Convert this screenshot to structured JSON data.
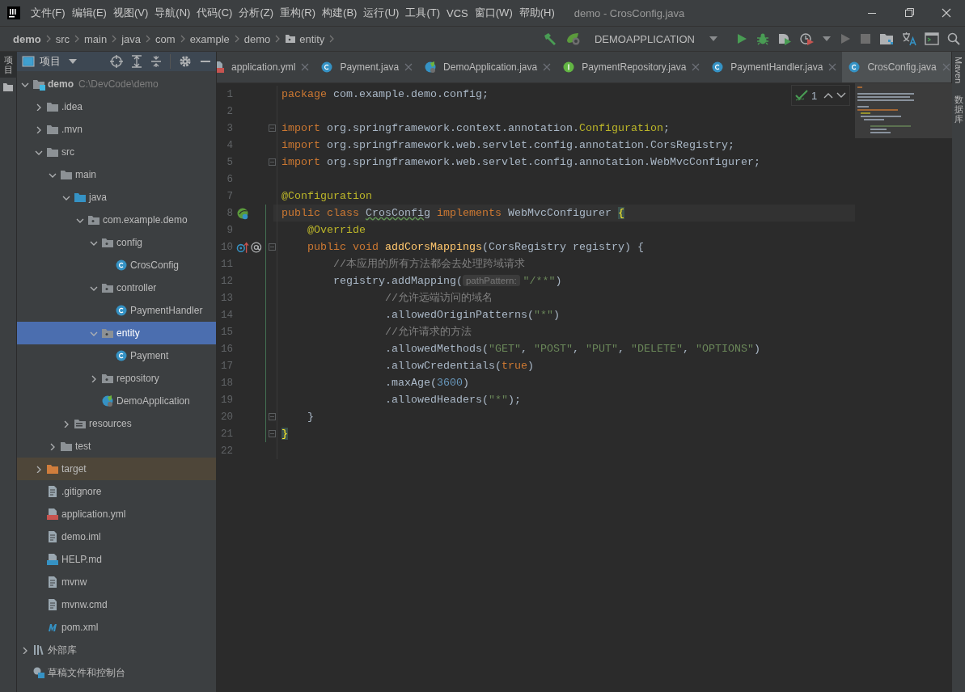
{
  "window": {
    "title": "demo - CrosConfig.java"
  },
  "menu": [
    "文件(F)",
    "编辑(E)",
    "视图(V)",
    "导航(N)",
    "代码(C)",
    "分析(Z)",
    "重构(R)",
    "构建(B)",
    "运行(U)",
    "工具(T)",
    "VCS",
    "窗口(W)",
    "帮助(H)"
  ],
  "breadcrumbs": [
    {
      "label": "demo",
      "kind": "root"
    },
    {
      "label": "src",
      "kind": "plain"
    },
    {
      "label": "main",
      "kind": "plain"
    },
    {
      "label": "java",
      "kind": "plain"
    },
    {
      "label": "com",
      "kind": "plain"
    },
    {
      "label": "example",
      "kind": "plain"
    },
    {
      "label": "demo",
      "kind": "plain"
    },
    {
      "label": "entity",
      "kind": "folder"
    }
  ],
  "run_config": {
    "label": "DEMOAPPLICATION"
  },
  "left_strip": {
    "label": "项目"
  },
  "project_panel": {
    "title": "项目"
  },
  "tree": [
    {
      "label": "demo",
      "path": "C:\\DevCode\\demo",
      "kind": "module",
      "selected": false,
      "expanded": true,
      "children": [
        {
          "label": ".idea",
          "kind": "folder",
          "selected": false,
          "expanded": false
        },
        {
          "label": ".mvn",
          "kind": "folder",
          "selected": false,
          "expanded": false
        },
        {
          "label": "src",
          "kind": "folder",
          "selected": false,
          "expanded": true,
          "children": [
            {
              "label": "main",
              "kind": "folder",
              "selected": false,
              "expanded": true,
              "children": [
                {
                  "label": "java",
                  "kind": "source",
                  "selected": false,
                  "expanded": true,
                  "children": [
                    {
                      "label": "com.example.demo",
                      "kind": "package",
                      "selected": false,
                      "expanded": true,
                      "children": [
                        {
                          "label": "config",
                          "kind": "package",
                          "selected": false,
                          "expanded": true,
                          "children": [
                            {
                              "label": "CrosConfig",
                              "kind": "class",
                              "selected": false
                            }
                          ]
                        },
                        {
                          "label": "controller",
                          "kind": "package",
                          "selected": false,
                          "expanded": true,
                          "children": [
                            {
                              "label": "PaymentHandler",
                              "kind": "class",
                              "selected": false
                            }
                          ]
                        },
                        {
                          "label": "entity",
                          "kind": "package",
                          "selected": true,
                          "expanded": true,
                          "children": [
                            {
                              "label": "Payment",
                              "kind": "class",
                              "selected": false
                            }
                          ]
                        },
                        {
                          "label": "repository",
                          "kind": "package",
                          "selected": false,
                          "expanded": false
                        },
                        {
                          "label": "DemoApplication",
                          "kind": "spring",
                          "selected": false
                        }
                      ]
                    }
                  ]
                },
                {
                  "label": "resources",
                  "kind": "resources",
                  "selected": false,
                  "expanded": false
                }
              ]
            },
            {
              "label": "test",
              "kind": "folder",
              "selected": false,
              "expanded": false
            }
          ]
        },
        {
          "label": "target",
          "kind": "excluded",
          "selected": false,
          "expanded": false
        },
        {
          "label": ".gitignore",
          "kind": "file",
          "selected": false
        },
        {
          "label": "application.yml",
          "kind": "yml",
          "selected": false
        },
        {
          "label": "demo.iml",
          "kind": "file",
          "selected": false
        },
        {
          "label": "HELP.md",
          "kind": "md",
          "selected": false
        },
        {
          "label": "mvnw",
          "kind": "file",
          "selected": false
        },
        {
          "label": "mvnw.cmd",
          "kind": "file",
          "selected": false
        },
        {
          "label": "pom.xml",
          "kind": "pom",
          "selected": false
        }
      ]
    },
    {
      "label": "外部库",
      "kind": "library",
      "selected": false,
      "expanded": false
    },
    {
      "label": "草稿文件和控制台",
      "kind": "scratch",
      "selected": false
    }
  ],
  "tabs": [
    {
      "label": "application.yml",
      "kind": "yml",
      "selected": false
    },
    {
      "label": "Payment.java",
      "kind": "class",
      "selected": false
    },
    {
      "label": "DemoApplication.java",
      "kind": "spring",
      "selected": false
    },
    {
      "label": "PaymentRepository.java",
      "kind": "interface",
      "selected": false
    },
    {
      "label": "PaymentHandler.java",
      "kind": "class",
      "selected": false
    },
    {
      "label": "CrosConfig.java",
      "kind": "class",
      "selected": true
    }
  ],
  "inspection": {
    "count": "1"
  },
  "right_strip": [
    {
      "label": "Maven",
      "kind": "latin"
    },
    {
      "label": "数据库",
      "kind": "cjk"
    }
  ],
  "code": [
    {
      "number": "1",
      "current": false,
      "changed": false,
      "fold": false,
      "tokens": [
        {
          "kind": "keyword",
          "text": "package"
        },
        {
          "kind": "plain",
          "text": " com.example.demo.config;"
        }
      ]
    },
    {
      "number": "2",
      "current": false,
      "changed": false,
      "fold": false
    },
    {
      "number": "3",
      "current": false,
      "changed": false,
      "fold": true,
      "tokens": [
        {
          "kind": "keyword",
          "text": "import"
        },
        {
          "kind": "plain",
          "text": " org.springframework.context.annotation."
        },
        {
          "kind": "annotation",
          "text": "Configuration"
        },
        {
          "kind": "plain",
          "text": ";"
        }
      ]
    },
    {
      "number": "4",
      "current": false,
      "changed": false,
      "fold": false,
      "tokens": [
        {
          "kind": "keyword",
          "text": "import"
        },
        {
          "kind": "plain",
          "text": " org.springframework.web.servlet.config.annotation.CorsRegistry;"
        }
      ]
    },
    {
      "number": "5",
      "current": false,
      "changed": false,
      "fold": true,
      "tokens": [
        {
          "kind": "keyword",
          "text": "import"
        },
        {
          "kind": "plain",
          "text": " org.springframework.web.servlet.config.annotation.WebMvcConfigurer;"
        }
      ]
    },
    {
      "number": "6",
      "current": false,
      "changed": false,
      "fold": false
    },
    {
      "number": "7",
      "current": false,
      "changed": false,
      "fold": false,
      "tokens": [
        {
          "kind": "annotation",
          "text": "@Configuration"
        }
      ]
    },
    {
      "number": "8",
      "current": true,
      "changed": true,
      "fold": false,
      "gutter": [
        {
          "kind": "bean"
        }
      ],
      "tokens": [
        {
          "kind": "keyword",
          "text": "public class "
        },
        {
          "kind": "typo",
          "text": "CrosConfig"
        },
        {
          "kind": "keyword",
          "text": " implements"
        },
        {
          "kind": "plain",
          "text": " WebMvcConfigurer "
        },
        {
          "kind": "brace",
          "text": "{"
        }
      ]
    },
    {
      "number": "9",
      "current": false,
      "changed": true,
      "fold": false,
      "tokens": [
        {
          "kind": "annotation",
          "text": "    @Override"
        }
      ]
    },
    {
      "number": "10",
      "current": false,
      "changed": true,
      "fold": true,
      "gutter": [
        {
          "kind": "override"
        },
        {
          "kind": "at"
        }
      ],
      "tokens": [
        {
          "kind": "keyword",
          "text": "    public void "
        },
        {
          "kind": "method",
          "text": "addCorsMappings"
        },
        {
          "kind": "plain",
          "text": "(CorsRegistry registry) {"
        }
      ]
    },
    {
      "number": "11",
      "current": false,
      "changed": true,
      "fold": false,
      "tokens": [
        {
          "kind": "comment",
          "text": "        //本应用的所有方法都会去处理跨域请求"
        }
      ]
    },
    {
      "number": "12",
      "current": false,
      "changed": true,
      "fold": false,
      "tokens": [
        {
          "kind": "plain",
          "text": "        registry.addMapping("
        },
        {
          "kind": "hint",
          "text": "pathPattern:"
        },
        {
          "kind": "string",
          "text": "\"/**\""
        },
        {
          "kind": "plain",
          "text": ")"
        }
      ]
    },
    {
      "number": "13",
      "current": false,
      "changed": true,
      "fold": false,
      "tokens": [
        {
          "kind": "comment",
          "text": "                //允许远端访问的域名"
        }
      ]
    },
    {
      "number": "14",
      "current": false,
      "changed": true,
      "fold": false,
      "tokens": [
        {
          "kind": "plain",
          "text": "                .allowedOriginPatterns("
        },
        {
          "kind": "string",
          "text": "\"*\""
        },
        {
          "kind": "plain",
          "text": ")"
        }
      ]
    },
    {
      "number": "15",
      "current": false,
      "changed": true,
      "fold": false,
      "tokens": [
        {
          "kind": "comment",
          "text": "                //允许请求的方法"
        }
      ]
    },
    {
      "number": "16",
      "current": false,
      "changed": true,
      "fold": false,
      "tokens": [
        {
          "kind": "plain",
          "text": "                .allowedMethods("
        },
        {
          "kind": "string",
          "text": "\"GET\""
        },
        {
          "kind": "plain",
          "text": ", "
        },
        {
          "kind": "string",
          "text": "\"POST\""
        },
        {
          "kind": "plain",
          "text": ", "
        },
        {
          "kind": "string",
          "text": "\"PUT\""
        },
        {
          "kind": "plain",
          "text": ", "
        },
        {
          "kind": "string",
          "text": "\"DELETE\""
        },
        {
          "kind": "plain",
          "text": ", "
        },
        {
          "kind": "string",
          "text": "\"OPTIONS\""
        },
        {
          "kind": "plain",
          "text": ")"
        }
      ]
    },
    {
      "number": "17",
      "current": false,
      "changed": true,
      "fold": false,
      "tokens": [
        {
          "kind": "plain",
          "text": "                .allowCredentials("
        },
        {
          "kind": "keyword",
          "text": "true"
        },
        {
          "kind": "plain",
          "text": ")"
        }
      ]
    },
    {
      "number": "18",
      "current": false,
      "changed": true,
      "fold": false,
      "tokens": [
        {
          "kind": "plain",
          "text": "                .maxAge("
        },
        {
          "kind": "number",
          "text": "3600"
        },
        {
          "kind": "plain",
          "text": ")"
        }
      ]
    },
    {
      "number": "19",
      "current": false,
      "changed": true,
      "fold": false,
      "tokens": [
        {
          "kind": "plain",
          "text": "                .allowedHeaders("
        },
        {
          "kind": "string",
          "text": "\"*\""
        },
        {
          "kind": "plain",
          "text": ");"
        }
      ]
    },
    {
      "number": "20",
      "current": false,
      "changed": true,
      "fold": true,
      "tokens": [
        {
          "kind": "plain",
          "text": "    }"
        }
      ]
    },
    {
      "number": "21",
      "current": false,
      "changed": true,
      "fold": true,
      "tokens": [
        {
          "kind": "brace",
          "text": "}"
        }
      ]
    },
    {
      "number": "22",
      "current": false,
      "changed": false,
      "fold": false
    }
  ]
}
